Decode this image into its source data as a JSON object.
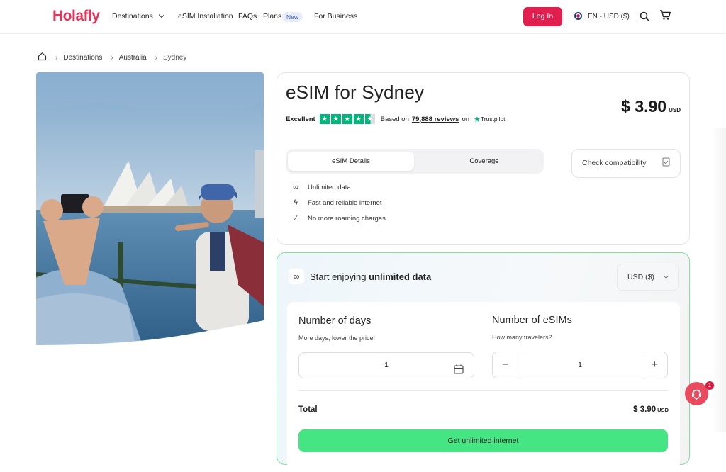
{
  "header": {
    "logo": "Holafly",
    "nav": [
      "Destinations",
      "eSIM Installation",
      "FAQs",
      "Plans",
      "For Business"
    ],
    "plans_badge": "New",
    "login": "Log In",
    "language": "EN - USD ($)"
  },
  "breadcrumb": [
    "Destinations",
    "Australia",
    "Sydney"
  ],
  "product": {
    "title": "eSIM for Sydney",
    "price": "$ 3.90",
    "price_currency": "USD",
    "rating_label": "Excellent",
    "stars": 4.5,
    "reviews_prefix": "Based on",
    "reviews_link": "79,888 reviews",
    "reviews_suffix": "on",
    "trustpilot": "Trustpilot",
    "tabs": [
      "eSIM Details",
      "Coverage"
    ],
    "check_compat": "Check compatibility",
    "features": [
      "Unlimited data",
      "Fast and reliable internet",
      "No more roaming charges"
    ]
  },
  "purchase": {
    "heading_prefix": "Start enjoying",
    "heading_bold": "unlimited data",
    "currency_select": "USD ($)",
    "days_title": "Number of days",
    "days_sub": "More days, lower the price!",
    "days_value": "1",
    "sims_title": "Number of eSIMs",
    "sims_sub": "How many travelers?",
    "sims_value": "1",
    "minus": "−",
    "plus": "+",
    "total_label": "Total",
    "total_value": "$ 3.90",
    "total_currency": "USD",
    "cta": "Get unlimited internet"
  },
  "chat": {
    "badge": "1"
  },
  "colors": {
    "brand": "#e01f4f",
    "cta": "#45e584",
    "trustpilot": "#00b67a"
  }
}
